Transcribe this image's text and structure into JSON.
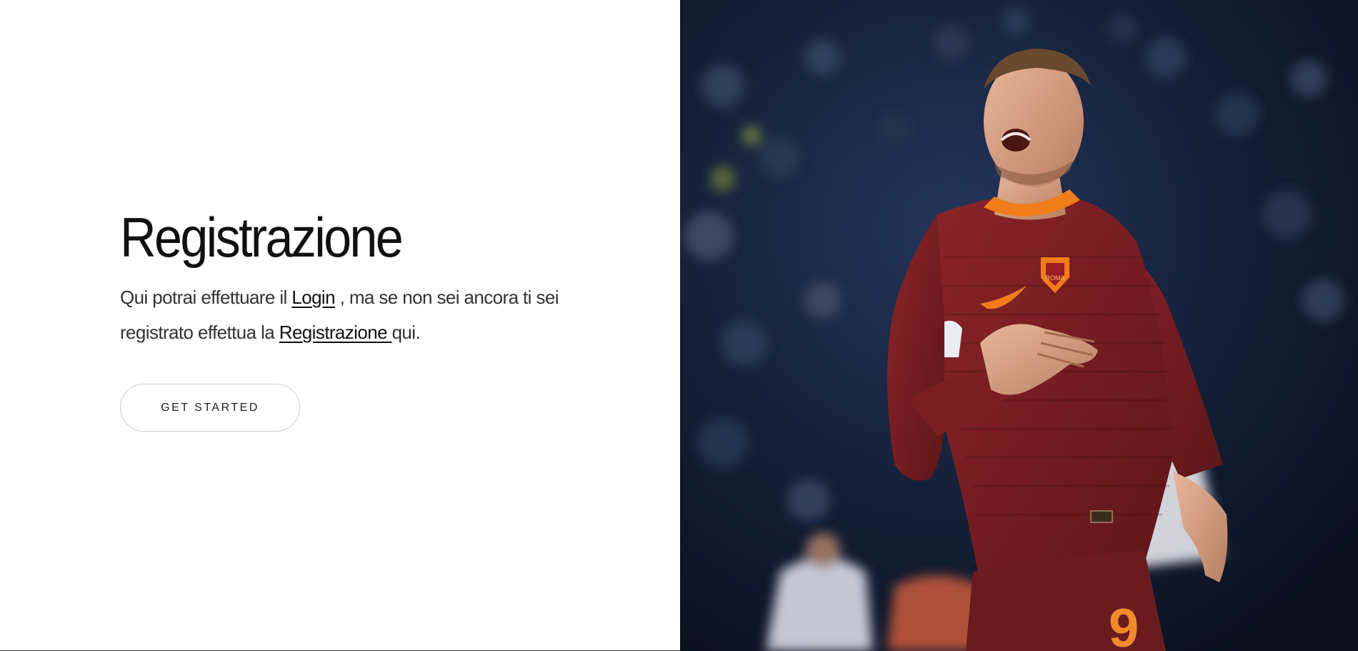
{
  "hero": {
    "title": "Registrazione",
    "desc_part1": "Qui potrai effettuare il ",
    "login_link": "Login",
    "desc_part2": " , ma se non sei ancora ti sei registrato effettua la ",
    "register_link": "Registrazione ",
    "desc_part3": "qui.",
    "cta_label": "GET STARTED"
  },
  "photo": {
    "subject": "football player in maroon jersey with number 9",
    "jersey_number": "9",
    "badge_text": "ROMA"
  },
  "colors": {
    "jersey": "#7a1e22",
    "collar": "#f07d1a",
    "background": "#ffffff",
    "stadium": "#101a2d"
  }
}
